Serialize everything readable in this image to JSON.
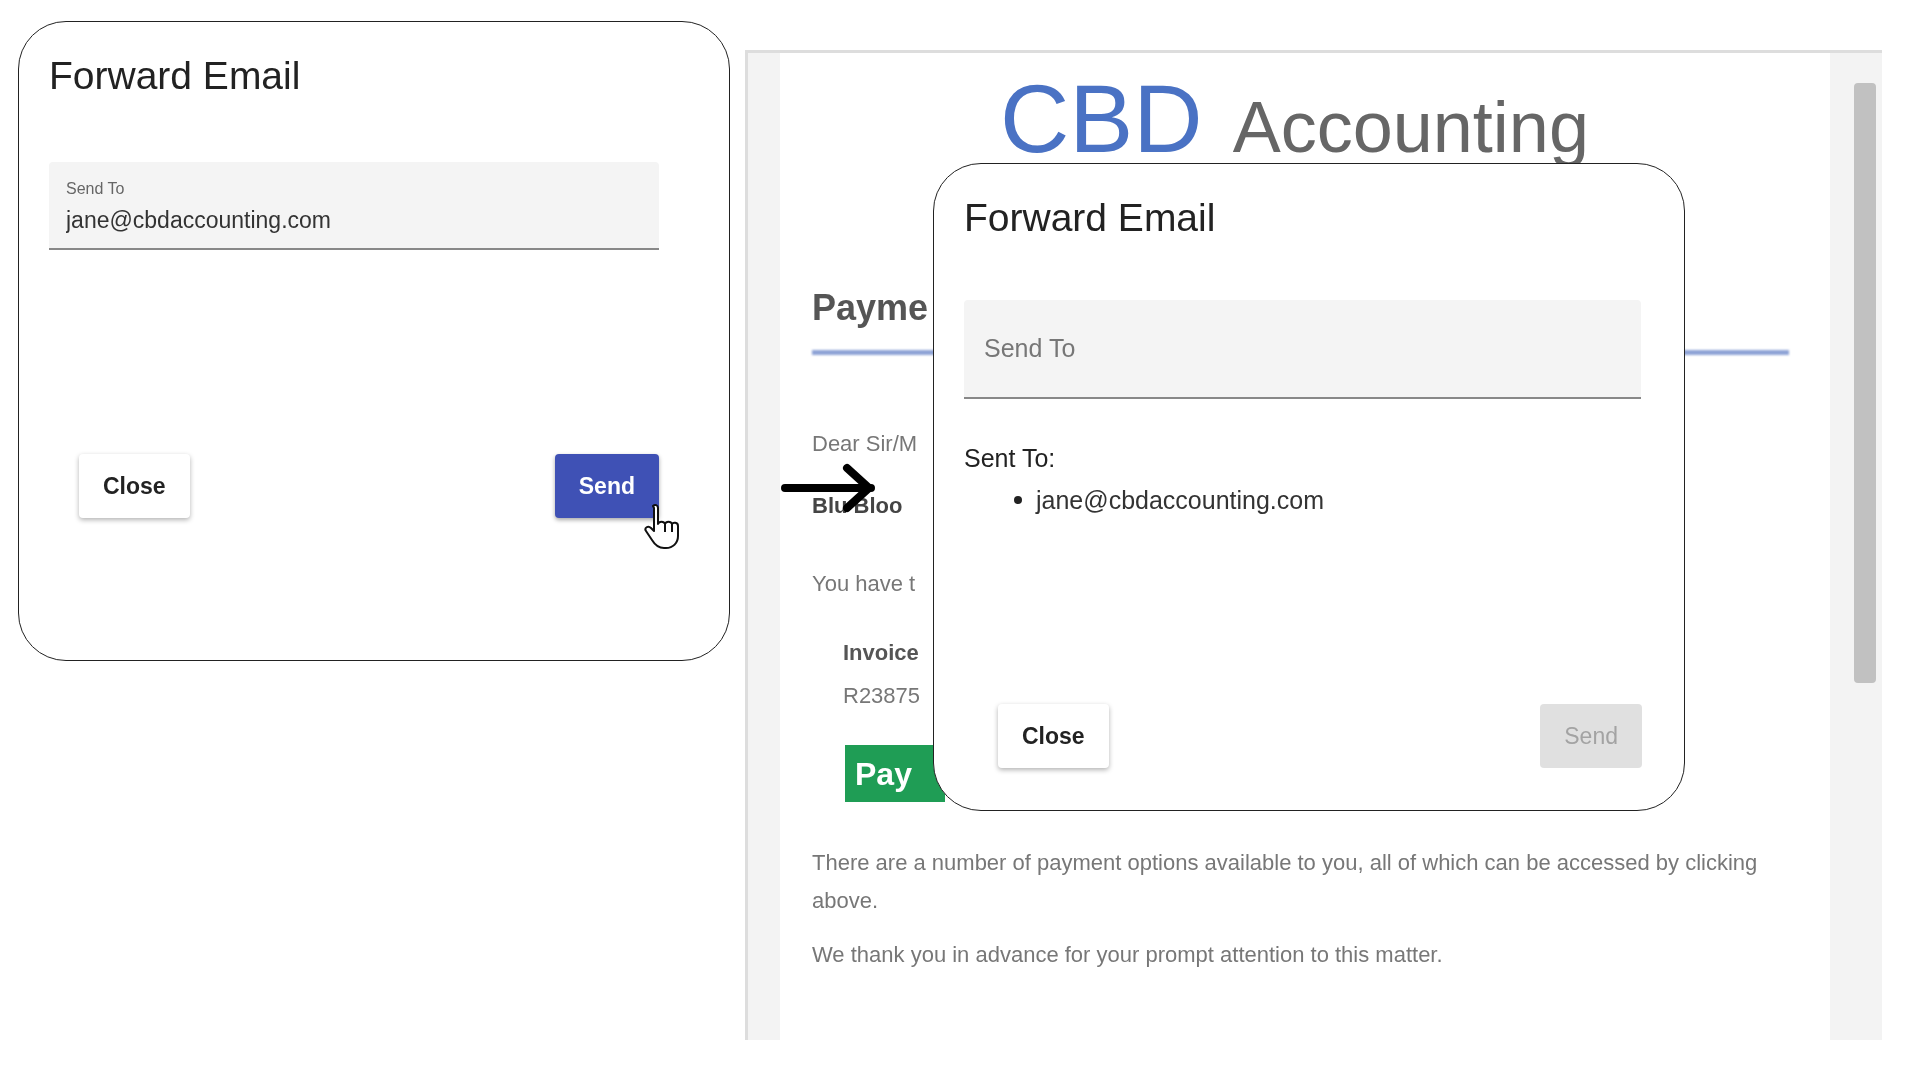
{
  "email_preview": {
    "logo": {
      "brand": "CBD",
      "suffix": "Accounting"
    },
    "heading": "Payme",
    "lines": [
      {
        "text": "Dear Sir/M",
        "bold": false
      },
      {
        "text": "Blu Bloo",
        "bold": true
      },
      {
        "text": "You have t",
        "bold": false
      }
    ],
    "invoice": {
      "label": "Invoice",
      "number": "R23875"
    },
    "pay_button": "Pay",
    "paragraphs": [
      "There are a number of payment options available to you, all of which can be accessed by clicking above.",
      "We thank you in advance for your prompt attention to this matter."
    ]
  },
  "dialogs": [
    {
      "title": "Forward Email",
      "field": {
        "label": "Send To",
        "value": "jane@cbdaccounting.com"
      },
      "buttons": [
        {
          "label": "Close",
          "kind": "plain",
          "disabled": false
        },
        {
          "label": "Send",
          "kind": "primary",
          "disabled": false
        }
      ],
      "pointer_on_send": true
    },
    {
      "title": "Forward Email",
      "field": {
        "placeholder": "Send To"
      },
      "sent_to": {
        "label": "Sent To:",
        "recipients": [
          "jane@cbdaccounting.com"
        ]
      },
      "buttons": [
        {
          "label": "Close",
          "kind": "plain",
          "disabled": false
        },
        {
          "label": "Send",
          "kind": "primary",
          "disabled": true
        }
      ],
      "pointer_on_send": false
    }
  ]
}
